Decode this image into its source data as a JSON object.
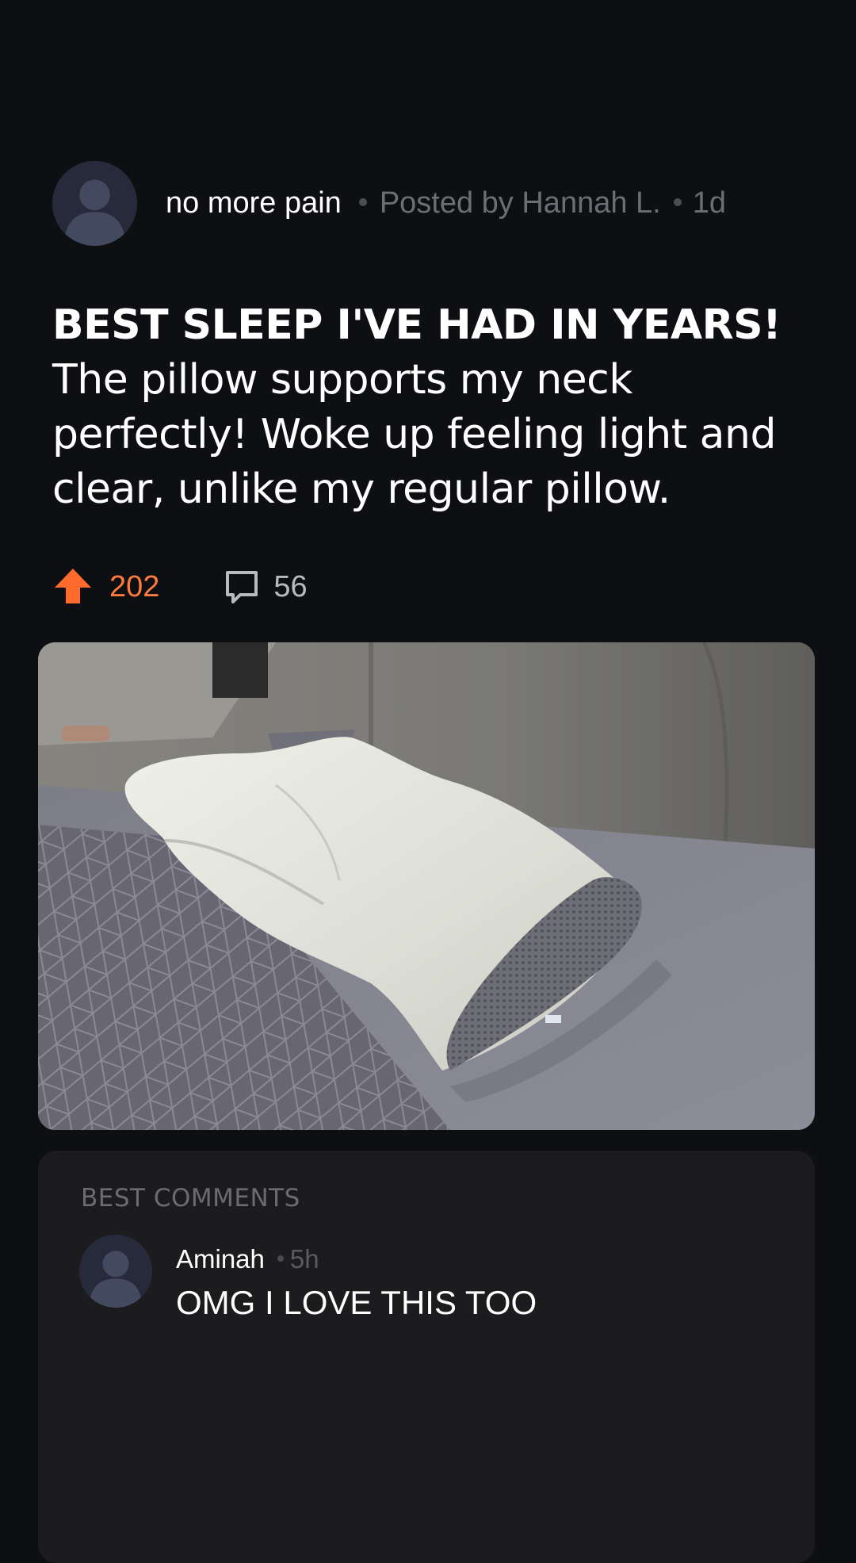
{
  "post": {
    "community": "no more pain",
    "posted_by": "Posted by Hannah L.",
    "age": "1d",
    "title": "BEST SLEEP I'VE HAD IN YEARS!",
    "body": "The pillow supports my neck perfectly! Woke up feeling light and clear, unlike my regular pillow.",
    "upvotes": "202",
    "comments": "56",
    "upvote_color": "#ff7a3d",
    "image": "contour-memory-foam-pillow-photo"
  },
  "comments_section": {
    "heading": "BEST COMMENTS",
    "items": [
      {
        "author": "Aminah",
        "age": "5h",
        "text": "OMG I LOVE THIS TOO"
      }
    ]
  }
}
